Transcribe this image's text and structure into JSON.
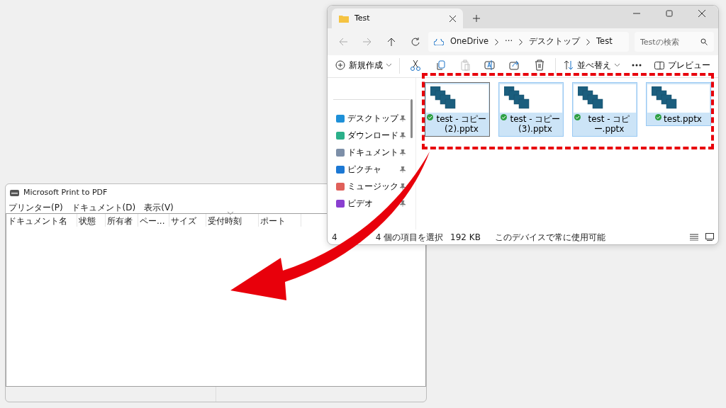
{
  "print_window": {
    "title": "Microsoft Print to PDF",
    "menu": [
      "プリンター(P)",
      "ドキュメント(D)",
      "表示(V)"
    ],
    "columns": [
      "ドキュメント名",
      "状態",
      "所有者",
      "ペー...",
      "サイズ",
      "受付時刻",
      "ポート"
    ]
  },
  "explorer": {
    "tabs": [
      {
        "label": "Test",
        "selected": true
      }
    ],
    "address": [
      "OneDrive",
      "···",
      "デスクトップ",
      "Test"
    ],
    "search": {
      "placeholder": "Testの検索"
    },
    "new_button": "新規作成",
    "sort_button": "並べ替え",
    "preview_button": "プレビュー",
    "icon_buttons": [
      {
        "disabled": false
      },
      {
        "disabled": false
      },
      {
        "disabled": true
      },
      {
        "disabled": false
      },
      {
        "disabled": false
      },
      {
        "disabled": false
      }
    ],
    "sidebar": [
      {
        "label": "デスクトップ",
        "color": "#1e90d8"
      },
      {
        "label": "ダウンロード",
        "color": "#2bb08a"
      },
      {
        "label": "ドキュメント",
        "color": "#7d8fa8"
      },
      {
        "label": "ピクチャ",
        "color": "#1c78d4"
      },
      {
        "label": "ミュージック",
        "color": "#e0605a"
      },
      {
        "label": "ビデオ",
        "color": "#8a3fd0"
      }
    ],
    "files": [
      {
        "name": "test - コピー (2).pptx",
        "selected": true,
        "focused": true
      },
      {
        "name": "test - コピー (3).pptx",
        "selected": true,
        "focused": false
      },
      {
        "name": "test - コピー.pptx",
        "selected": true,
        "focused": false
      },
      {
        "name": "test.pptx",
        "selected": true,
        "focused": false
      }
    ],
    "status": [
      "4",
      "4 個の項目を選択",
      "192 KB",
      "このデバイスで常に使用可能"
    ]
  }
}
